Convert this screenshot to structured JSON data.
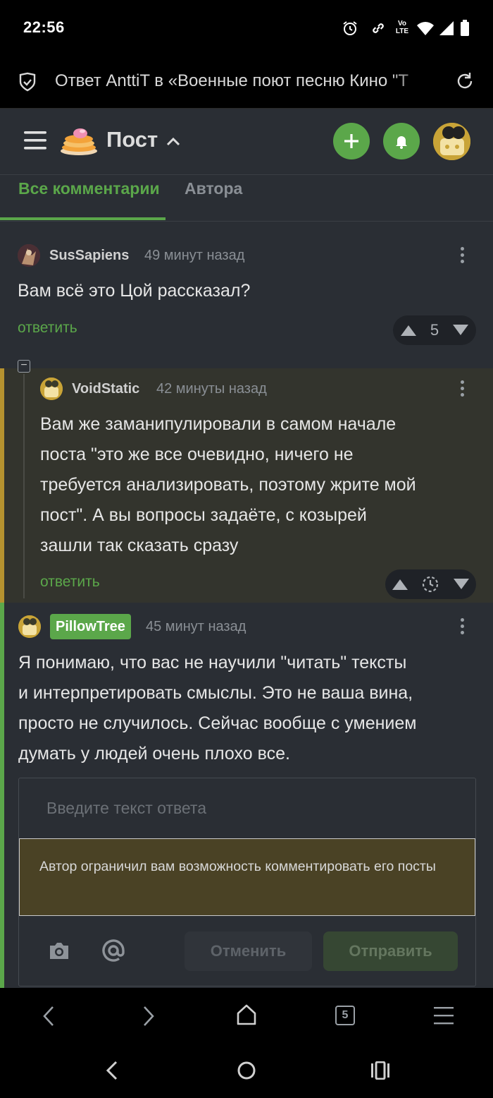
{
  "status_bar": {
    "time": "22:56",
    "icons": [
      "alarm-icon",
      "link-icon",
      "volte-icon",
      "wifi-icon",
      "signal-icon",
      "battery-icon"
    ],
    "volte_label_top": "Vo",
    "volte_label_bottom": "LTE"
  },
  "browser": {
    "url_title": "Ответ AnttiT в «Военные поют песню Кино \"Т"
  },
  "header": {
    "title": "Пост",
    "add_icon": "plus-icon",
    "bell_icon": "bell-icon"
  },
  "tabs": [
    {
      "label": "Все комментарии",
      "active": true
    },
    {
      "label": "Автора",
      "active": false
    }
  ],
  "comments": [
    {
      "author": "SusSapiens",
      "time": "49 минут назад",
      "text": "Вам всё это Цой рассказал?",
      "reply_label": "ответить",
      "score": "5"
    },
    {
      "author": "VoidStatic",
      "time": "42 минуты назад",
      "text_lines": [
        "Вам же заманипулировали в самом начале",
        "поста \"это же все очевидно, ничего не",
        "требуется анализировать, поэтому жрите мой",
        "пост\". А вы вопросы задаёте, с козырей",
        "зашли так сказать сразу"
      ],
      "reply_label": "ответить",
      "collapse_symbol": "−"
    },
    {
      "author": "PillowTree",
      "time": "45 минут назад",
      "text_lines": [
        "Я понимаю, что вас не научили \"читать\" тексты",
        "и интерпретировать смыслы. Это не ваша вина,",
        "просто не случилось. Сейчас вообще с умением",
        "думать у людей очень плохо все."
      ]
    }
  ],
  "reply_box": {
    "placeholder": "Введите текст ответа",
    "notice": "Автор ограничил вам возможность комментировать его посты",
    "cancel_label": "Отменить",
    "send_label": "Отправить"
  },
  "browser_nav": {
    "tab_count": "5"
  },
  "colors": {
    "accent": "#5ba74a",
    "background": "#2a2e34",
    "nested_background": "#33342d",
    "thread_line_yellow": "#b5922f",
    "notice_background": "#4a4225"
  }
}
